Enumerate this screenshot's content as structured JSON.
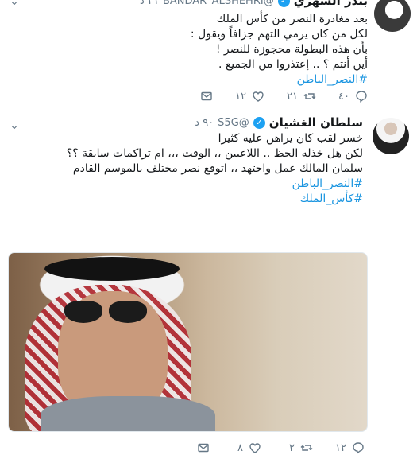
{
  "tweets": [
    {
      "name": "بندر الشهري",
      "handle": "BANDAR_ALSHEHRI@",
      "time": "٢١ د",
      "body": [
        "بعد مغادرة النصر من كأس الملك",
        "لكل من كان يرمي التهم جزافاً ويقول :",
        "بأن هذه البطولة محجوزة للنصر !",
        "أين أنتم ؟ .. إعتذروا من الجميع ."
      ],
      "hashtags": [
        "#النصر_الباطن"
      ],
      "replies": "٤٠",
      "retweets": "٢١",
      "likes": "١٢"
    },
    {
      "name": "سلطان الغشيان",
      "handle": "S5G@",
      "time": "٩٠ د",
      "body": [
        "خسر لقب كان يراهن عليه كثيرا",
        "لكن هل خذله الحظ .. اللاعبين ،، الوقت ،،، ام تراكمات سابقة ؟؟",
        "سلمان المالك عمل واجتهد ،، اتوقع نصر مختلف بالموسم القادم"
      ],
      "hashtags": [
        "#النصر_الباطن",
        "#كأس_الملك"
      ],
      "replies": "١٢",
      "retweets": "٢",
      "likes": "٨"
    }
  ],
  "icons": {
    "reply": "reply-icon",
    "retweet": "retweet-icon",
    "like": "heart-icon",
    "dm": "envelope-icon",
    "more": "chevron-down-icon",
    "verified": "verified-badge-icon"
  },
  "colors": {
    "link": "#1b95e0",
    "verified": "#1da1f2",
    "meta": "#657786",
    "text": "#14171a"
  }
}
